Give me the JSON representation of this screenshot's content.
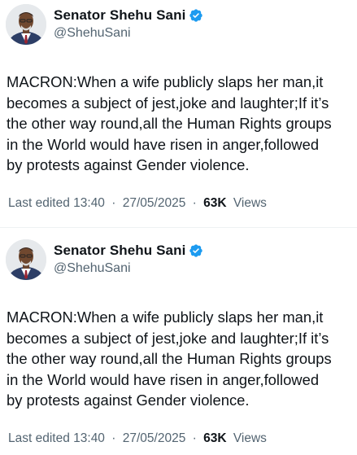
{
  "tweets": [
    {
      "display_name": "Senator Shehu Sani",
      "handle": "@ShehuSani",
      "verified_icon": "verified-badge-icon",
      "body_lines": [
        "MACRON:When a wife publicly slaps her man,it",
        "becomes a subject of jest,joke and laughter;If it’s",
        "the other way round,all the Human Rights groups",
        "in the World would have risen in anger,followed",
        "by protests against Gender violence."
      ],
      "edited_label": "Last edited 13:40",
      "separator": "·",
      "date": "27/05/2025",
      "views_count": "63K",
      "views_label": "Views"
    },
    {
      "display_name": "Senator Shehu Sani",
      "handle": "@ShehuSani",
      "verified_icon": "verified-badge-icon",
      "body_lines": [
        "MACRON:When a wife publicly slaps her man,it",
        "becomes a subject of jest,joke and laughter;If it’s",
        "the other way round,all the Human Rights groups",
        "in the World would have risen in anger,followed",
        "by protests against Gender violence."
      ],
      "edited_label": "Last edited 13:40",
      "separator": "·",
      "date": "27/05/2025",
      "views_count": "63K",
      "views_label": "Views"
    }
  ],
  "colors": {
    "verified_blue": "#1d9bf0",
    "primary_text": "#0f1419",
    "secondary_text": "#536471"
  }
}
